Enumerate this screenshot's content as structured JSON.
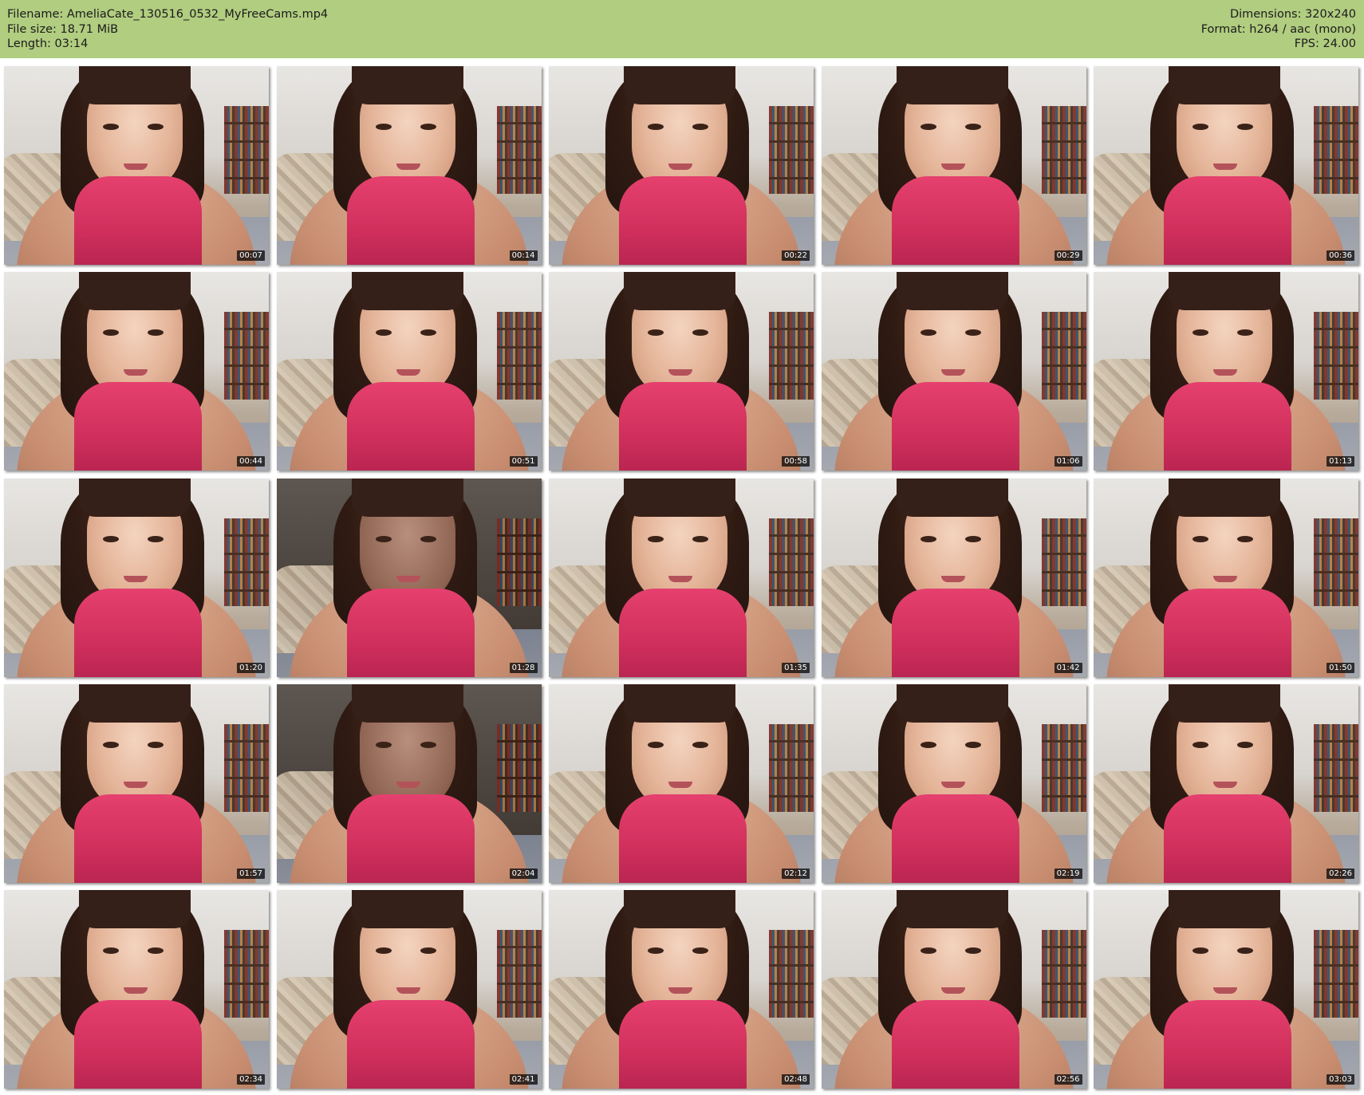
{
  "header": {
    "filename": "Filename: AmeliaCate_130516_0532_MyFreeCams.mp4",
    "file_size": "File size: 18.71 MiB",
    "length": "Length: 03:14",
    "dimensions": "Dimensions: 320x240",
    "format": "Format: h264 / aac (mono)",
    "fps": "FPS: 24.00"
  },
  "colors": {
    "header_bg": "#b1cd80",
    "page_bg": "#ffffff"
  },
  "thumbnails": [
    {
      "ts": "00:07"
    },
    {
      "ts": "00:14"
    },
    {
      "ts": "00:22"
    },
    {
      "ts": "00:29"
    },
    {
      "ts": "00:36"
    },
    {
      "ts": "00:44"
    },
    {
      "ts": "00:51"
    },
    {
      "ts": "00:58"
    },
    {
      "ts": "01:06"
    },
    {
      "ts": "01:13"
    },
    {
      "ts": "01:20"
    },
    {
      "ts": "01:28"
    },
    {
      "ts": "01:35"
    },
    {
      "ts": "01:42"
    },
    {
      "ts": "01:50"
    },
    {
      "ts": "01:57"
    },
    {
      "ts": "02:04"
    },
    {
      "ts": "02:12"
    },
    {
      "ts": "02:19"
    },
    {
      "ts": "02:26"
    },
    {
      "ts": "02:34"
    },
    {
      "ts": "02:41"
    },
    {
      "ts": "02:48"
    },
    {
      "ts": "02:56"
    },
    {
      "ts": "03:03"
    }
  ]
}
